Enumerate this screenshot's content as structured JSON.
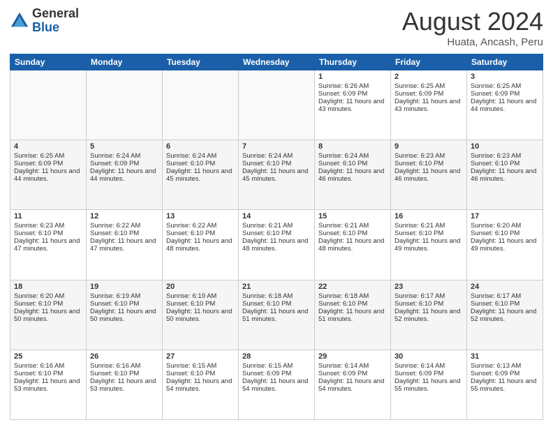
{
  "header": {
    "logo_general": "General",
    "logo_blue": "Blue",
    "title": "August 2024",
    "location": "Huata, Ancash, Peru"
  },
  "days_of_week": [
    "Sunday",
    "Monday",
    "Tuesday",
    "Wednesday",
    "Thursday",
    "Friday",
    "Saturday"
  ],
  "weeks": [
    [
      {
        "day": "",
        "info": ""
      },
      {
        "day": "",
        "info": ""
      },
      {
        "day": "",
        "info": ""
      },
      {
        "day": "",
        "info": ""
      },
      {
        "day": "1",
        "info": "Sunrise: 6:26 AM\nSunset: 6:09 PM\nDaylight: 11 hours and 43 minutes."
      },
      {
        "day": "2",
        "info": "Sunrise: 6:25 AM\nSunset: 6:09 PM\nDaylight: 11 hours and 43 minutes."
      },
      {
        "day": "3",
        "info": "Sunrise: 6:25 AM\nSunset: 6:09 PM\nDaylight: 11 hours and 44 minutes."
      }
    ],
    [
      {
        "day": "4",
        "info": "Sunrise: 6:25 AM\nSunset: 6:09 PM\nDaylight: 11 hours and 44 minutes."
      },
      {
        "day": "5",
        "info": "Sunrise: 6:24 AM\nSunset: 6:09 PM\nDaylight: 11 hours and 44 minutes."
      },
      {
        "day": "6",
        "info": "Sunrise: 6:24 AM\nSunset: 6:10 PM\nDaylight: 11 hours and 45 minutes."
      },
      {
        "day": "7",
        "info": "Sunrise: 6:24 AM\nSunset: 6:10 PM\nDaylight: 11 hours and 45 minutes."
      },
      {
        "day": "8",
        "info": "Sunrise: 6:24 AM\nSunset: 6:10 PM\nDaylight: 11 hours and 46 minutes."
      },
      {
        "day": "9",
        "info": "Sunrise: 6:23 AM\nSunset: 6:10 PM\nDaylight: 11 hours and 46 minutes."
      },
      {
        "day": "10",
        "info": "Sunrise: 6:23 AM\nSunset: 6:10 PM\nDaylight: 11 hours and 46 minutes."
      }
    ],
    [
      {
        "day": "11",
        "info": "Sunrise: 6:23 AM\nSunset: 6:10 PM\nDaylight: 11 hours and 47 minutes."
      },
      {
        "day": "12",
        "info": "Sunrise: 6:22 AM\nSunset: 6:10 PM\nDaylight: 11 hours and 47 minutes."
      },
      {
        "day": "13",
        "info": "Sunrise: 6:22 AM\nSunset: 6:10 PM\nDaylight: 11 hours and 48 minutes."
      },
      {
        "day": "14",
        "info": "Sunrise: 6:21 AM\nSunset: 6:10 PM\nDaylight: 11 hours and 48 minutes."
      },
      {
        "day": "15",
        "info": "Sunrise: 6:21 AM\nSunset: 6:10 PM\nDaylight: 11 hours and 48 minutes."
      },
      {
        "day": "16",
        "info": "Sunrise: 6:21 AM\nSunset: 6:10 PM\nDaylight: 11 hours and 49 minutes."
      },
      {
        "day": "17",
        "info": "Sunrise: 6:20 AM\nSunset: 6:10 PM\nDaylight: 11 hours and 49 minutes."
      }
    ],
    [
      {
        "day": "18",
        "info": "Sunrise: 6:20 AM\nSunset: 6:10 PM\nDaylight: 11 hours and 50 minutes."
      },
      {
        "day": "19",
        "info": "Sunrise: 6:19 AM\nSunset: 6:10 PM\nDaylight: 11 hours and 50 minutes."
      },
      {
        "day": "20",
        "info": "Sunrise: 6:19 AM\nSunset: 6:10 PM\nDaylight: 11 hours and 50 minutes."
      },
      {
        "day": "21",
        "info": "Sunrise: 6:18 AM\nSunset: 6:10 PM\nDaylight: 11 hours and 51 minutes."
      },
      {
        "day": "22",
        "info": "Sunrise: 6:18 AM\nSunset: 6:10 PM\nDaylight: 11 hours and 51 minutes."
      },
      {
        "day": "23",
        "info": "Sunrise: 6:17 AM\nSunset: 6:10 PM\nDaylight: 11 hours and 52 minutes."
      },
      {
        "day": "24",
        "info": "Sunrise: 6:17 AM\nSunset: 6:10 PM\nDaylight: 11 hours and 52 minutes."
      }
    ],
    [
      {
        "day": "25",
        "info": "Sunrise: 6:16 AM\nSunset: 6:10 PM\nDaylight: 11 hours and 53 minutes."
      },
      {
        "day": "26",
        "info": "Sunrise: 6:16 AM\nSunset: 6:10 PM\nDaylight: 11 hours and 53 minutes."
      },
      {
        "day": "27",
        "info": "Sunrise: 6:15 AM\nSunset: 6:10 PM\nDaylight: 11 hours and 54 minutes."
      },
      {
        "day": "28",
        "info": "Sunrise: 6:15 AM\nSunset: 6:09 PM\nDaylight: 11 hours and 54 minutes."
      },
      {
        "day": "29",
        "info": "Sunrise: 6:14 AM\nSunset: 6:09 PM\nDaylight: 11 hours and 54 minutes."
      },
      {
        "day": "30",
        "info": "Sunrise: 6:14 AM\nSunset: 6:09 PM\nDaylight: 11 hours and 55 minutes."
      },
      {
        "day": "31",
        "info": "Sunrise: 6:13 AM\nSunset: 6:09 PM\nDaylight: 11 hours and 55 minutes."
      }
    ]
  ]
}
